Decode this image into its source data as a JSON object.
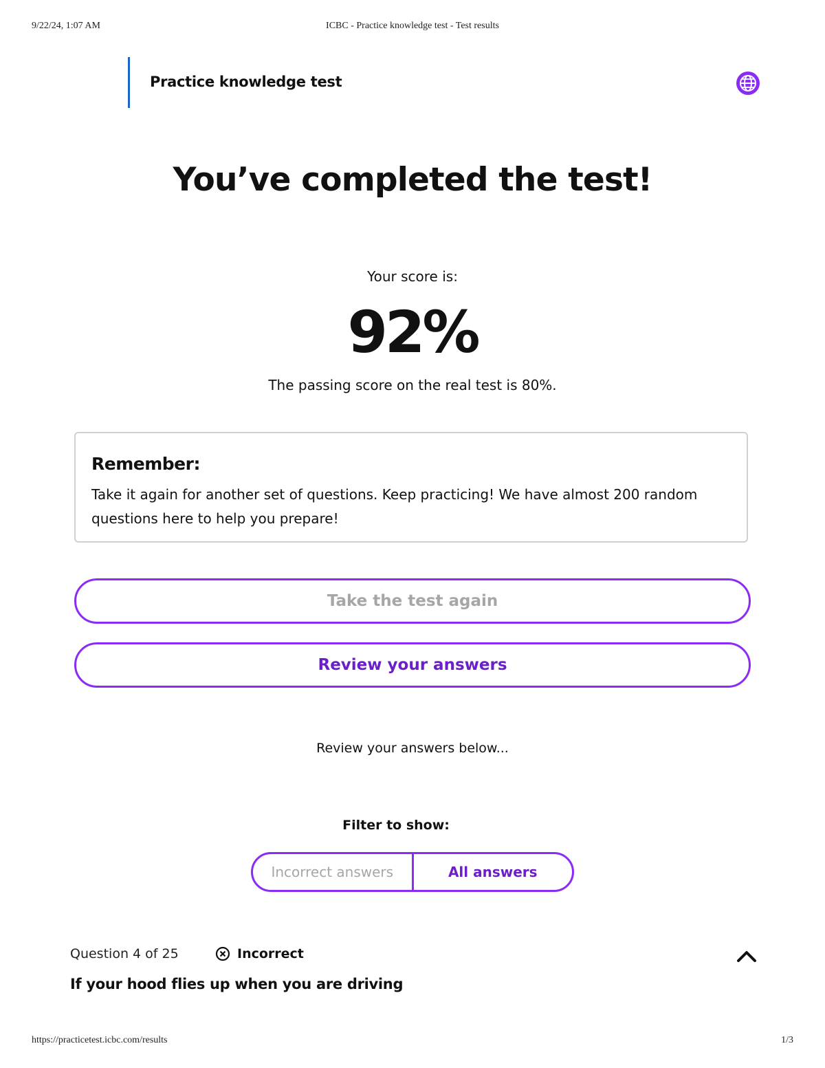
{
  "print": {
    "date": "9/22/24, 1:07 AM",
    "title": "ICBC - Practice knowledge test - Test results",
    "url": "https://practicetest.icbc.com/results",
    "page": "1/3"
  },
  "header": {
    "title": "Practice knowledge test",
    "language_icon": "globe-icon"
  },
  "results": {
    "headline": "You’ve completed the test!",
    "score_label": "Your score is:",
    "score": "92%",
    "passing_note": "The passing score on the real test is 80%."
  },
  "remember": {
    "title": "Remember:",
    "body": "Take it again for another set of questions. Keep practicing! We have almost 200 random questions here to help you prepare!"
  },
  "actions": {
    "take_again": "Take the test again",
    "review": "Review your answers"
  },
  "review_note": "Review your answers below...",
  "filter": {
    "label": "Filter to show:",
    "options": [
      "Incorrect answers",
      "All answers"
    ],
    "selected": "All answers"
  },
  "question": {
    "counter": "Question 4 of 25",
    "status": "Incorrect",
    "status_icon": "x-circle-icon",
    "text": "If your hood flies up when you are driving",
    "collapse_icon": "chevron-up-icon"
  },
  "colors": {
    "accent": "#8b2cf5",
    "accent_text": "#6a1fc7",
    "bar": "#1a66c9"
  }
}
